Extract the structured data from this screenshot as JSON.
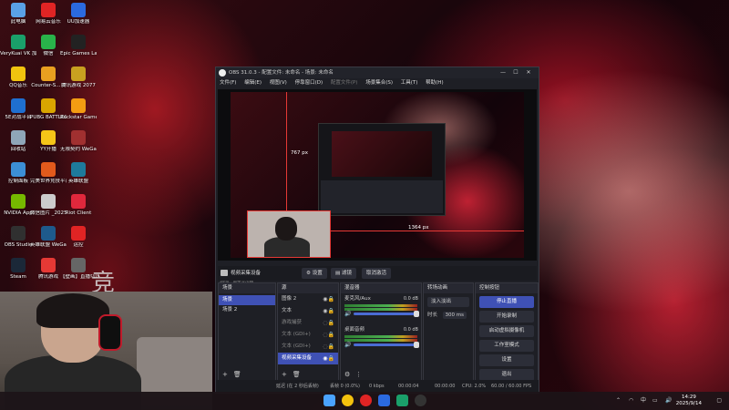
{
  "desktop": {
    "icons": [
      {
        "label": "此电脑",
        "color": "#5aa0e6"
      },
      {
        "label": "网易云音乐",
        "color": "#e02424"
      },
      {
        "label": "UU加速器",
        "color": "#2b6ae0"
      },
      {
        "label": "VeryKuai VK 加速器",
        "color": "#1aa06a"
      },
      {
        "label": "微信",
        "color": "#29b34a"
      },
      {
        "label": "Epic Games Launcher",
        "color": "#222222"
      },
      {
        "label": "QQ音乐",
        "color": "#f1c40f"
      },
      {
        "label": "Counter-S... 2",
        "color": "#e8a020"
      },
      {
        "label": "腾讯游戏 2077",
        "color": "#c8a020"
      },
      {
        "label": "5E对战平台",
        "color": "#1f6fd0"
      },
      {
        "label": "PUBG BATTLEGR...",
        "color": "#d9a600"
      },
      {
        "label": "Rockstar Games...",
        "color": "#f39c12"
      },
      {
        "label": "回收站",
        "color": "#8fa6b8"
      },
      {
        "label": "YY开播",
        "color": "#f5c518"
      },
      {
        "label": "无限契约 WeGame版",
        "color": "#a03030"
      },
      {
        "label": "控制面板",
        "color": "#3c8fd6"
      },
      {
        "label": "完美世界竞技平台",
        "color": "#e25a1c"
      },
      {
        "label": "英雄联盟",
        "color": "#1e7a9c"
      },
      {
        "label": "NVIDIA App",
        "color": "#76b900"
      },
      {
        "label": "微信图片 _2025-06-...",
        "color": "#cccccc"
      },
      {
        "label": "Riot Client",
        "color": "#e0283c"
      },
      {
        "label": "OBS Studio",
        "color": "#303030"
      },
      {
        "label": "英雄联盟 WeGame版",
        "color": "#1e5a8c"
      },
      {
        "label": "运控",
        "color": "#e02424"
      },
      {
        "label": "Steam",
        "color": "#1b2838"
      },
      {
        "label": "腾讯游戏",
        "color": "#e53935"
      },
      {
        "label": "【壁画】直播切片（三国...",
        "color": "#666666"
      }
    ],
    "overlay_glyph": "竞"
  },
  "obs": {
    "title": "OBS 31.0.3 - 配置文件: 未命名 - 场景: 未命名",
    "menu": [
      "文件(F)",
      "编辑(E)",
      "视图(V)",
      "停靠窗口(D)",
      "配置文件(P)",
      "场景集合(S)",
      "工具(T)",
      "帮助(H)"
    ],
    "preview": {
      "dim_vertical": "767 px",
      "dim_horizontal": "1364 px",
      "zoom": "39%",
      "zoom_hint": "调整显示器"
    },
    "source_bar": {
      "source_name": "视频采集设备",
      "properties": "设置",
      "filters": "滤镜",
      "deactivate": "取消激活"
    },
    "scenes": {
      "title": "场景",
      "items": [
        "场景",
        "场景 2"
      ]
    },
    "sources": {
      "title": "源",
      "items": [
        "图像 2",
        "文本",
        "游戏捕获",
        "文本 (GDI+)",
        "文本 (GDI+)",
        "视频采集设备"
      ]
    },
    "mixer": {
      "title": "混音器",
      "tracks": [
        {
          "name": "麦克风/Aux",
          "db": "0.0 dB"
        },
        {
          "name": "桌面音频",
          "db": "0.0 dB"
        }
      ]
    },
    "transitions": {
      "title": "转场动画",
      "type": "淡入淡出",
      "duration_label": "时长",
      "duration": "300 ms"
    },
    "controls": {
      "title": "控制按钮",
      "buttons": [
        "停止直播",
        "开始录制",
        "启动虚拟摄像机",
        "工作室模式",
        "设置",
        "退出"
      ]
    },
    "status": {
      "frames": "延迟 (在 2 秒后丢帧)",
      "dropped": "丢帧 0 (0.0%)",
      "bitrate": "0 kbps",
      "live_time": "00:00:04",
      "rec_time": "00:00:00",
      "cpu": "CPU: 2.0%",
      "fps": "60.00 / 60.00 FPS"
    }
  },
  "taskbar": {
    "tray_lang": "中",
    "clock_time": "14:29",
    "clock_date": "2025/9/14"
  }
}
